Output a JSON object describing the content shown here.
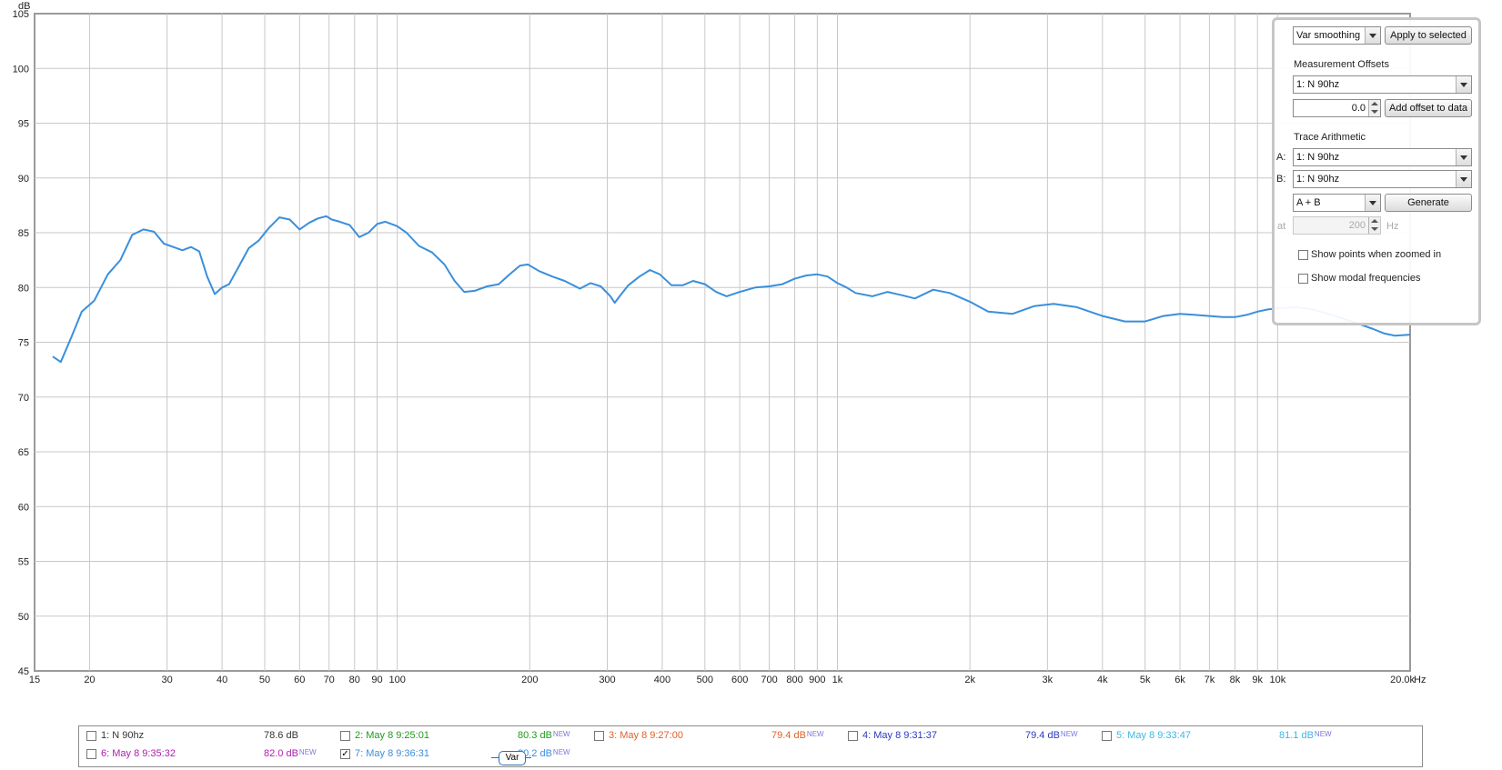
{
  "chart_data": {
    "type": "line",
    "ylabel": "dB",
    "xunit": "Hz",
    "xscale": "log",
    "xlim": [
      15,
      20000
    ],
    "ylim": [
      45,
      105
    ],
    "y_ticks": [
      "105",
      "100",
      "95",
      "90",
      "85",
      "80",
      "75",
      "70",
      "65",
      "60",
      "55",
      "50",
      "45"
    ],
    "x_ticks": [
      {
        "f": 15,
        "label": "15"
      },
      {
        "f": 20,
        "label": "20"
      },
      {
        "f": 30,
        "label": "30"
      },
      {
        "f": 40,
        "label": "40"
      },
      {
        "f": 50,
        "label": "50"
      },
      {
        "f": 60,
        "label": "60"
      },
      {
        "f": 70,
        "label": "70"
      },
      {
        "f": 80,
        "label": "80"
      },
      {
        "f": 90,
        "label": "90"
      },
      {
        "f": 100,
        "label": "100"
      },
      {
        "f": 200,
        "label": "200"
      },
      {
        "f": 300,
        "label": "300"
      },
      {
        "f": 400,
        "label": "400"
      },
      {
        "f": 500,
        "label": "500"
      },
      {
        "f": 600,
        "label": "600"
      },
      {
        "f": 700,
        "label": "700"
      },
      {
        "f": 800,
        "label": "800"
      },
      {
        "f": 900,
        "label": "900"
      },
      {
        "f": 1000,
        "label": "1k"
      },
      {
        "f": 2000,
        "label": "2k"
      },
      {
        "f": 3000,
        "label": "3k"
      },
      {
        "f": 4000,
        "label": "4k"
      },
      {
        "f": 5000,
        "label": "5k"
      },
      {
        "f": 6000,
        "label": "6k"
      },
      {
        "f": 7000,
        "label": "7k"
      },
      {
        "f": 8000,
        "label": "8k"
      },
      {
        "f": 9000,
        "label": "9k"
      },
      {
        "f": 10000,
        "label": "10k"
      },
      {
        "f": 20000,
        "label": "20.0k"
      }
    ],
    "grid": true,
    "series": [
      {
        "name": "7: May 8 9:36:31",
        "color": "#3a8fdc",
        "points": [
          [
            16.5,
            73.7
          ],
          [
            17.2,
            73.2
          ],
          [
            18.2,
            75.5
          ],
          [
            19.2,
            77.8
          ],
          [
            20.5,
            78.8
          ],
          [
            22,
            81.2
          ],
          [
            23.5,
            82.5
          ],
          [
            25,
            84.8
          ],
          [
            26.5,
            85.3
          ],
          [
            28,
            85.1
          ],
          [
            29.5,
            84
          ],
          [
            31,
            83.7
          ],
          [
            32.5,
            83.4
          ],
          [
            34,
            83.7
          ],
          [
            35.5,
            83.3
          ],
          [
            37,
            81
          ],
          [
            38.5,
            79.4
          ],
          [
            40,
            80
          ],
          [
            41.5,
            80.3
          ],
          [
            43.5,
            81.8
          ],
          [
            46,
            83.6
          ],
          [
            48.5,
            84.3
          ],
          [
            51,
            85.4
          ],
          [
            54,
            86.4
          ],
          [
            57,
            86.2
          ],
          [
            60,
            85.3
          ],
          [
            63,
            85.9
          ],
          [
            66,
            86.3
          ],
          [
            69,
            86.5
          ],
          [
            71,
            86.2
          ],
          [
            74,
            86
          ],
          [
            78,
            85.7
          ],
          [
            82,
            84.6
          ],
          [
            86,
            85
          ],
          [
            90,
            85.8
          ],
          [
            94,
            86
          ],
          [
            100,
            85.6
          ],
          [
            105,
            85
          ],
          [
            112,
            83.8
          ],
          [
            120,
            83.2
          ],
          [
            128,
            82.1
          ],
          [
            135,
            80.6
          ],
          [
            142,
            79.6
          ],
          [
            150,
            79.7
          ],
          [
            160,
            80.1
          ],
          [
            170,
            80.3
          ],
          [
            180,
            81.2
          ],
          [
            190,
            82
          ],
          [
            198,
            82.1
          ],
          [
            210,
            81.5
          ],
          [
            225,
            81
          ],
          [
            240,
            80.6
          ],
          [
            260,
            79.9
          ],
          [
            275,
            80.4
          ],
          [
            290,
            80.1
          ],
          [
            305,
            79.2
          ],
          [
            312,
            78.6
          ],
          [
            320,
            79.2
          ],
          [
            335,
            80.2
          ],
          [
            355,
            81
          ],
          [
            375,
            81.6
          ],
          [
            395,
            81.2
          ],
          [
            420,
            80.2
          ],
          [
            445,
            80.2
          ],
          [
            470,
            80.6
          ],
          [
            500,
            80.3
          ],
          [
            530,
            79.6
          ],
          [
            560,
            79.2
          ],
          [
            600,
            79.6
          ],
          [
            650,
            80
          ],
          [
            700,
            80.1
          ],
          [
            750,
            80.3
          ],
          [
            800,
            80.8
          ],
          [
            850,
            81.1
          ],
          [
            900,
            81.2
          ],
          [
            950,
            81
          ],
          [
            1000,
            80.4
          ],
          [
            1050,
            80
          ],
          [
            1100,
            79.5
          ],
          [
            1200,
            79.2
          ],
          [
            1300,
            79.6
          ],
          [
            1400,
            79.3
          ],
          [
            1500,
            79
          ],
          [
            1650,
            79.8
          ],
          [
            1800,
            79.5
          ],
          [
            2000,
            78.7
          ],
          [
            2200,
            77.8
          ],
          [
            2500,
            77.6
          ],
          [
            2800,
            78.3
          ],
          [
            3100,
            78.5
          ],
          [
            3500,
            78.2
          ],
          [
            4000,
            77.4
          ],
          [
            4500,
            76.9
          ],
          [
            5000,
            76.9
          ],
          [
            5500,
            77.4
          ],
          [
            6000,
            77.6
          ],
          [
            6500,
            77.5
          ],
          [
            7000,
            77.4
          ],
          [
            7500,
            77.3
          ],
          [
            8000,
            77.3
          ],
          [
            8500,
            77.5
          ],
          [
            9000,
            77.8
          ],
          [
            9500,
            78
          ],
          [
            10000,
            78.1
          ],
          [
            11000,
            78.2
          ],
          [
            12000,
            78
          ],
          [
            13000,
            77.6
          ],
          [
            14000,
            77.2
          ],
          [
            15000,
            76.8
          ],
          [
            16500,
            76.2
          ],
          [
            17500,
            75.8
          ],
          [
            18500,
            75.6
          ],
          [
            20000,
            75.7
          ]
        ]
      }
    ]
  },
  "panel": {
    "smoothing_value": "Var smoothing",
    "apply_button": "Apply to selected",
    "offsets_title": "Measurement Offsets",
    "offsets_select": "1: N 90hz",
    "offset_value": "0.0",
    "add_offset_button": "Add offset to data",
    "arith_title": "Trace Arithmetic",
    "a_label": "A:",
    "a_value": "1: N 90hz",
    "b_label": "B:",
    "b_value": "1: N 90hz",
    "op_value": "A + B",
    "generate_button": "Generate",
    "at_label": "at",
    "at_value": "200",
    "hz_label": "Hz",
    "show_points": "Show points when zoomed in",
    "show_modal": "Show modal frequencies"
  },
  "legend": {
    "items": [
      {
        "name": "1: N 90hz",
        "value": "78.6 dB",
        "tag": "",
        "color": "#333333",
        "checked": false
      },
      {
        "name": "2: May 8 9:25:01",
        "value": "80.3 dB",
        "tag": "NEW",
        "color": "#1e9a1e",
        "checked": false
      },
      {
        "name": "3: May 8 9:27:00",
        "value": "79.4 dB",
        "tag": "NEW",
        "color": "#e0602a",
        "checked": false
      },
      {
        "name": "4: May 8 9:31:37",
        "value": "79.4 dB",
        "tag": "NEW",
        "color": "#2a3ac0",
        "checked": false
      },
      {
        "name": "5: May 8 9:33:47",
        "value": "81.1 dB",
        "tag": "NEW",
        "color": "#3fb6e6",
        "checked": false
      },
      {
        "name": "6: May 8 9:35:32",
        "value": "82.0 dB",
        "tag": "NEW",
        "color": "#b01cb0",
        "checked": false
      },
      {
        "name": "7: May 8 9:36:31",
        "value": "80.2 dB",
        "tag": "NEW",
        "color": "#3a8fdc",
        "checked": true
      }
    ],
    "var_badge": "Var",
    "new_tag_1": "NEW"
  }
}
